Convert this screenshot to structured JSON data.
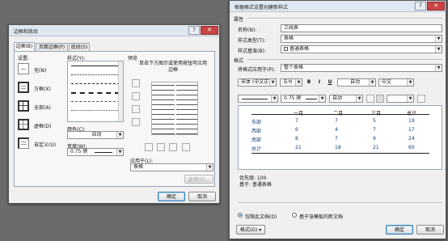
{
  "borders_dialog": {
    "title": "边框和底纹",
    "tabs": [
      "边框(B)",
      "页面边框(P)",
      "底纹(S)"
    ],
    "settings_label": "设置:",
    "settings": [
      "无(N)",
      "方框(X)",
      "全部(A)",
      "虚框(D)",
      "自定义(U)"
    ],
    "style_label": "样式(Y):",
    "color_label": "颜色(C):",
    "color_value": "自动",
    "width_label": "宽度(W):",
    "width_value": "0.75 磅",
    "preview_label": "预览",
    "preview_hint": "单击下方图示或使用按钮可应用边框",
    "apply_to_label": "应用于(L):",
    "apply_to_value": "表格",
    "options_button": "选项(O)...",
    "ok_button": "确定",
    "cancel_button": "取消"
  },
  "style_dialog": {
    "title": "根据格式设置创建新样式",
    "properties_label": "属性",
    "name_label": "名称(N):",
    "name_value": "三线表",
    "type_label": "样式类型(T):",
    "type_value": "表格",
    "based_on_label": "样式基准(B):",
    "based_on_value": "普通表格",
    "format_label": "格式",
    "apply_to_label": "将格式应用于(P):",
    "apply_to_value": "整个表格",
    "font_value": "宋体 (中文正文)",
    "size_value": "五号",
    "bold": "B",
    "italic": "I",
    "underline": "U",
    "font_color_value": "自动",
    "script_value": "中文",
    "border_width_value": "0.75 磅",
    "border_color_value": "自动",
    "table_headers": [
      "",
      "一月",
      "二月",
      "三月",
      "总计"
    ],
    "table_rows": [
      [
        "东部",
        "7",
        "7",
        "5",
        "19"
      ],
      [
        "西部",
        "6",
        "4",
        "7",
        "17"
      ],
      [
        "南部",
        "8",
        "7",
        "9",
        "24"
      ],
      [
        "总计",
        "21",
        "18",
        "21",
        "60"
      ]
    ],
    "priority_text": "优先级: 100",
    "based_on_text": "基于: 普通表格",
    "radio_only_doc": "仅限此文档(D)",
    "radio_new_docs": "基于该模板的新文档",
    "format_button": "格式(O) ▾",
    "ok_button": "确定",
    "cancel_button": "取消"
  }
}
